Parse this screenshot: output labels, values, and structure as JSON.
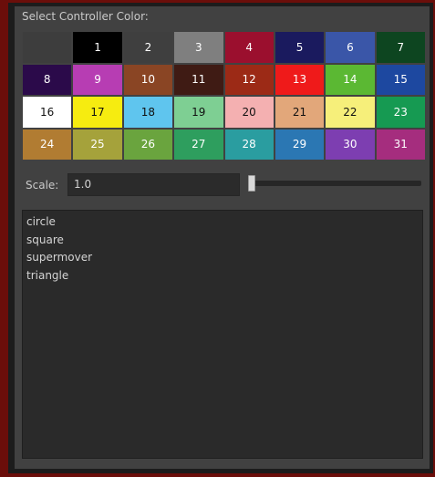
{
  "dialog": {
    "title": "Select Controller Color:"
  },
  "palette": {
    "swatches": [
      {
        "label": "",
        "color": "#3d3d3d",
        "text_color": "#ffffff"
      },
      {
        "label": "1",
        "color": "#000000",
        "text_color": "#ffffff"
      },
      {
        "label": "2",
        "color": "#3f3f3f",
        "text_color": "#ffffff"
      },
      {
        "label": "3",
        "color": "#7f7f7f",
        "text_color": "#ffffff"
      },
      {
        "label": "4",
        "color": "#9b0f2e",
        "text_color": "#ffffff"
      },
      {
        "label": "5",
        "color": "#1a1a5e",
        "text_color": "#ffffff"
      },
      {
        "label": "6",
        "color": "#3a56a8",
        "text_color": "#ffffff"
      },
      {
        "label": "7",
        "color": "#0d4520",
        "text_color": "#ffffff"
      },
      {
        "label": "8",
        "color": "#2b0a4a",
        "text_color": "#ffffff"
      },
      {
        "label": "9",
        "color": "#b73db3",
        "text_color": "#ffffff"
      },
      {
        "label": "10",
        "color": "#8a4524",
        "text_color": "#ffffff"
      },
      {
        "label": "11",
        "color": "#3f1b14",
        "text_color": "#ffffff"
      },
      {
        "label": "12",
        "color": "#9c2a16",
        "text_color": "#ffffff"
      },
      {
        "label": "13",
        "color": "#ef1a1a",
        "text_color": "#ffffff"
      },
      {
        "label": "14",
        "color": "#5bb833",
        "text_color": "#ffffff"
      },
      {
        "label": "15",
        "color": "#1d48a0",
        "text_color": "#ffffff"
      },
      {
        "label": "16",
        "color": "#ffffff",
        "text_color": "#111111"
      },
      {
        "label": "17",
        "color": "#f6ec10",
        "text_color": "#111111"
      },
      {
        "label": "18",
        "color": "#5fc5ee",
        "text_color": "#111111"
      },
      {
        "label": "19",
        "color": "#7ecf93",
        "text_color": "#111111"
      },
      {
        "label": "20",
        "color": "#f4b0b1",
        "text_color": "#111111"
      },
      {
        "label": "21",
        "color": "#e2a77a",
        "text_color": "#111111"
      },
      {
        "label": "22",
        "color": "#f6ef7a",
        "text_color": "#111111"
      },
      {
        "label": "23",
        "color": "#169a52",
        "text_color": "#ffffff"
      },
      {
        "label": "24",
        "color": "#b17c32",
        "text_color": "#ffffff"
      },
      {
        "label": "25",
        "color": "#a5a23b",
        "text_color": "#ffffff"
      },
      {
        "label": "26",
        "color": "#6aa43e",
        "text_color": "#ffffff"
      },
      {
        "label": "27",
        "color": "#2e9e5e",
        "text_color": "#ffffff"
      },
      {
        "label": "28",
        "color": "#2a9da0",
        "text_color": "#ffffff"
      },
      {
        "label": "29",
        "color": "#2b77b3",
        "text_color": "#ffffff"
      },
      {
        "label": "30",
        "color": "#7d3eb1",
        "text_color": "#ffffff"
      },
      {
        "label": "31",
        "color": "#a52d7e",
        "text_color": "#ffffff"
      }
    ]
  },
  "scale": {
    "label": "Scale:",
    "value": "1.0",
    "slider_level": 0
  },
  "shapes": {
    "items": [
      "circle",
      "square",
      "supermover",
      "triangle"
    ]
  },
  "colors": {
    "background": "#6b0e0a",
    "dialog": "#414141",
    "field": "#2b2b2b",
    "text": "#c9c9c9"
  }
}
